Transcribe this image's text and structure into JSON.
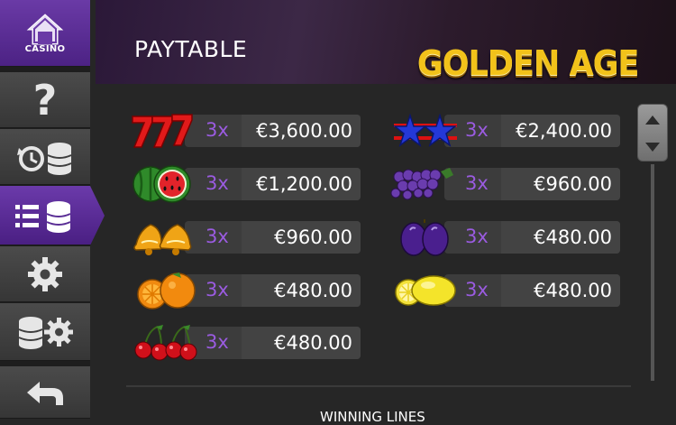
{
  "sidebar": {
    "home_label": "CASINO",
    "items": [
      "home-icon",
      "question-icon",
      "history-coins-icon",
      "paytable-list-icon",
      "gear-icon",
      "coins-gear-icon",
      "back-arrow-icon"
    ]
  },
  "header": {
    "title": "PAYTABLE",
    "logo_text": "GOLDEN AGE"
  },
  "paytable": [
    {
      "symbol": "seven-icon",
      "multiplier": "3x",
      "payout": "€3,600.00"
    },
    {
      "symbol": "stars-icon",
      "multiplier": "3x",
      "payout": "€2,400.00"
    },
    {
      "symbol": "watermelon-icon",
      "multiplier": "3x",
      "payout": "€1,200.00"
    },
    {
      "symbol": "grapes-icon",
      "multiplier": "3x",
      "payout": "€960.00"
    },
    {
      "symbol": "bells-icon",
      "multiplier": "3x",
      "payout": "€960.00"
    },
    {
      "symbol": "plums-icon",
      "multiplier": "3x",
      "payout": "€480.00"
    },
    {
      "symbol": "oranges-icon",
      "multiplier": "3x",
      "payout": "€480.00"
    },
    {
      "symbol": "lemons-icon",
      "multiplier": "3x",
      "payout": "€480.00"
    },
    {
      "symbol": "cherries-icon",
      "multiplier": "3x",
      "payout": "€480.00"
    }
  ],
  "footer": {
    "section_title": "WINNING LINES"
  },
  "colors": {
    "accent": "#6b3aaa",
    "multiplier": "#9a5be0",
    "logo": "#f2c21a"
  }
}
